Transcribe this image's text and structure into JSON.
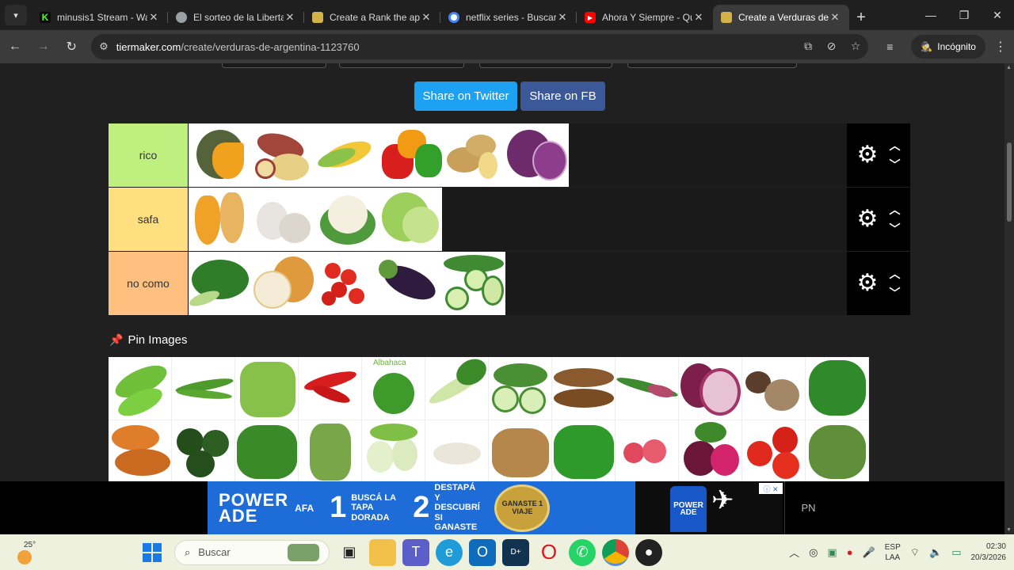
{
  "browser": {
    "tabs": [
      {
        "title": "minusis1 Stream - Wa",
        "icon_color": "#53fc18",
        "active": false
      },
      {
        "title": "El sorteo de la Liberta",
        "icon_color": "#9aa0a6",
        "active": false
      },
      {
        "title": "Create a Rank the app",
        "icon_color": "#d4b24a",
        "active": false
      },
      {
        "title": "netflix series - Buscar",
        "icon_color": "#4285f4",
        "active": false
      },
      {
        "title": "Ahora Y Siempre - Qu",
        "icon_color": "#ff0000",
        "active": false
      },
      {
        "title": "Create a Verduras de",
        "icon_color": "#d4b24a",
        "active": true
      }
    ],
    "new_tab": "+",
    "url_host": "tiermaker.com",
    "url_path": "/create/verduras-de-argentina-1123760",
    "incognito_label": "Incógnito",
    "window_controls": [
      "minimize-icon",
      "restore-icon",
      "close-icon"
    ]
  },
  "page": {
    "share_twitter": "Share on Twitter",
    "share_fb": "Share on FB",
    "tiers": [
      {
        "label": "rico",
        "color": "#bff07f",
        "items": [
          "calabaza",
          "batata",
          "choclo",
          "morron",
          "papa",
          "repollo-morado"
        ]
      },
      {
        "label": "safa",
        "color": "#ffdf80",
        "items": [
          "anco",
          "ajo",
          "coliflor",
          "repollo"
        ]
      },
      {
        "label": "no como",
        "color": "#ffbf7f",
        "items": [
          "acelga",
          "cebolla",
          "tomate-cherry",
          "berenjena",
          "pepino"
        ]
      }
    ],
    "pin_images_title": "Pin Images",
    "pool_row1": [
      "arvejas",
      "chauchas",
      "apio",
      "aji",
      "albahaca",
      "puerro",
      "zucchini",
      "mandioca",
      "cebolla-verdeo",
      "cebolla-morada",
      "hongos",
      "espinaca"
    ],
    "pool_row2": [
      "batata-2",
      "limon",
      "rucula",
      "esparrago",
      "hinojo",
      "brotes",
      "jengibre",
      "perejil",
      "rabanito",
      "remolacha",
      "tomate",
      "alcaucil"
    ],
    "albahaca_label": "Albahaca",
    "ad": {
      "brand_line1": "POWER",
      "brand_line2": "ADE",
      "afa": "AFA",
      "step1_num": "1",
      "step1_text": "BUSCÁ LA TAPA DORADA",
      "step2_num": "2",
      "step2_text": "DESTAPÁ Y DESCUBRÍ SI GANASTE",
      "coin_text": "GANASTE 1 VIAJE",
      "bottle_text": "POWER ADE",
      "pn": "PN"
    }
  },
  "taskbar": {
    "temperature": "25°",
    "search_placeholder": "Buscar",
    "lang_line1": "ESP",
    "lang_line2": "LAA",
    "time": "02:30",
    "date": "20/3/2026"
  }
}
